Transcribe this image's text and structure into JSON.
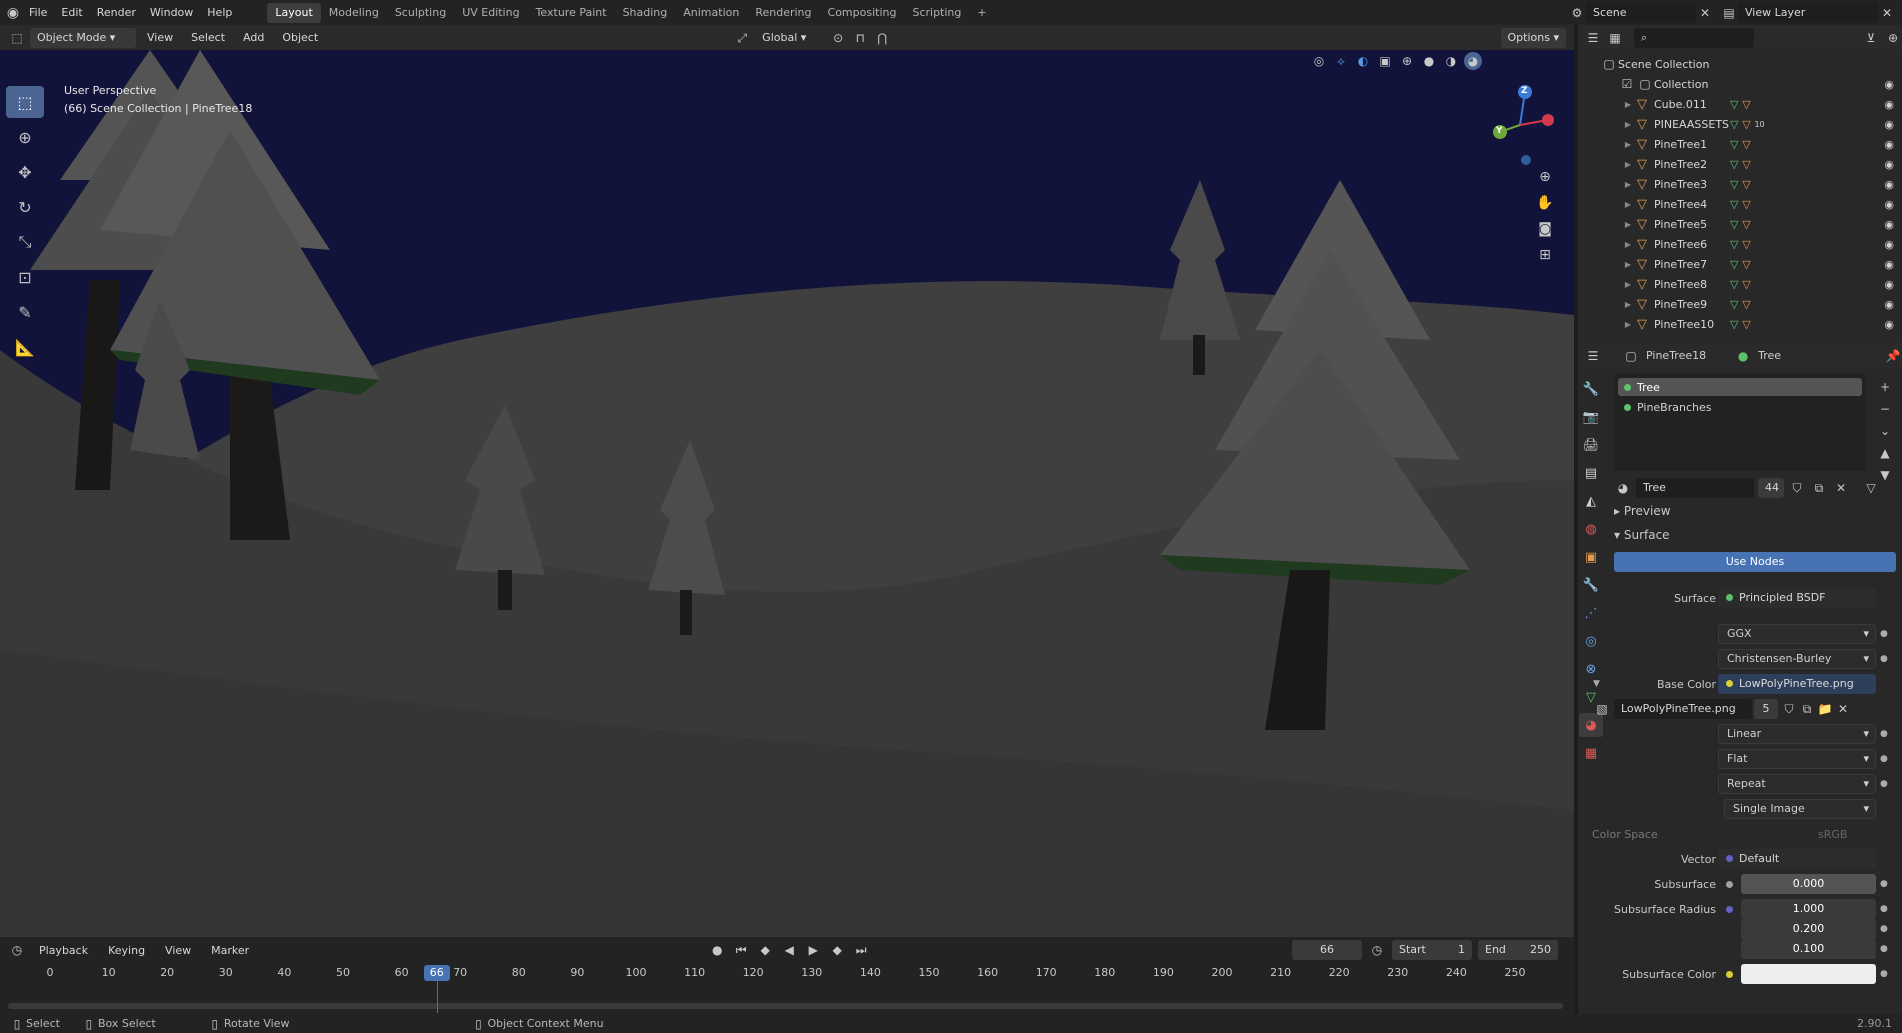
{
  "menus": [
    "File",
    "Edit",
    "Render",
    "Window",
    "Help"
  ],
  "workspaces": [
    "Layout",
    "Modeling",
    "Sculpting",
    "UV Editing",
    "Texture Paint",
    "Shading",
    "Animation",
    "Rendering",
    "Compositing",
    "Scripting"
  ],
  "add_workspace": "+",
  "scene_name": "Scene",
  "view_layer_name": "View Layer",
  "viewport_header": {
    "mode": "Object Mode",
    "menus": [
      "View",
      "Select",
      "Add",
      "Object"
    ],
    "orientation": "Global",
    "options": "Options"
  },
  "viewport": {
    "perspective": "User Perspective",
    "context": "(66) Scene Collection | PineTree18",
    "sky_color": "#12133a",
    "ground_color": "#3a3a3a",
    "gizmo_labels": {
      "z": "Z",
      "y": "Y"
    }
  },
  "outliner": {
    "root": "Scene Collection",
    "collection": "Collection",
    "items": [
      {
        "name": "Cube.011",
        "extra": ""
      },
      {
        "name": "PINEAASSETS",
        "extra": "10"
      },
      {
        "name": "PineTree1",
        "extra": ""
      },
      {
        "name": "PineTree2",
        "extra": ""
      },
      {
        "name": "PineTree3",
        "extra": ""
      },
      {
        "name": "PineTree4",
        "extra": ""
      },
      {
        "name": "PineTree5",
        "extra": ""
      },
      {
        "name": "PineTree6",
        "extra": ""
      },
      {
        "name": "PineTree7",
        "extra": ""
      },
      {
        "name": "PineTree8",
        "extra": ""
      },
      {
        "name": "PineTree9",
        "extra": ""
      },
      {
        "name": "PineTree10",
        "extra": ""
      }
    ]
  },
  "properties": {
    "object": "PineTree18",
    "material_tab": "Tree",
    "slots": [
      "Tree",
      "PineBranches"
    ],
    "material_name": "Tree",
    "user_count": "44",
    "panel_preview": "Preview",
    "panel_surface": "Surface",
    "use_nodes": "Use Nodes",
    "fields": {
      "surface_label": "Surface",
      "surface_value": "Principled BSDF",
      "distribution": "GGX",
      "subsurface_method": "Christensen-Burley",
      "base_color_label": "Base Color",
      "base_color_value": "LowPolyPineTree.png",
      "image_name": "LowPolyPineTree.png",
      "image_users": "5",
      "interpolation": "Linear",
      "projection": "Flat",
      "extension": "Repeat",
      "source": "Single Image",
      "color_space_label": "Color Space",
      "color_space_value": "sRGB",
      "vector_label": "Vector",
      "vector_value": "Default",
      "subsurface_label": "Subsurface",
      "subsurface_value": "0.000",
      "radius_label": "Subsurface Radius",
      "radius_values": [
        "1.000",
        "0.200",
        "0.100"
      ],
      "subsurface_color_label": "Subsurface Color"
    }
  },
  "timeline": {
    "menus": [
      "Playback",
      "Keying",
      "View",
      "Marker"
    ],
    "current_frame": "66",
    "start_label": "Start",
    "start_value": "1",
    "end_label": "End",
    "end_value": "250",
    "ruler": [
      0,
      10,
      20,
      30,
      40,
      50,
      60,
      70,
      80,
      90,
      100,
      110,
      120,
      130,
      140,
      150,
      160,
      170,
      180,
      190,
      200,
      210,
      220,
      230,
      240,
      250
    ]
  },
  "statusbar": {
    "select": "Select",
    "box_select": "Box Select",
    "rotate": "Rotate View",
    "context_menu": "Object Context Menu",
    "version": "2.90.1"
  }
}
